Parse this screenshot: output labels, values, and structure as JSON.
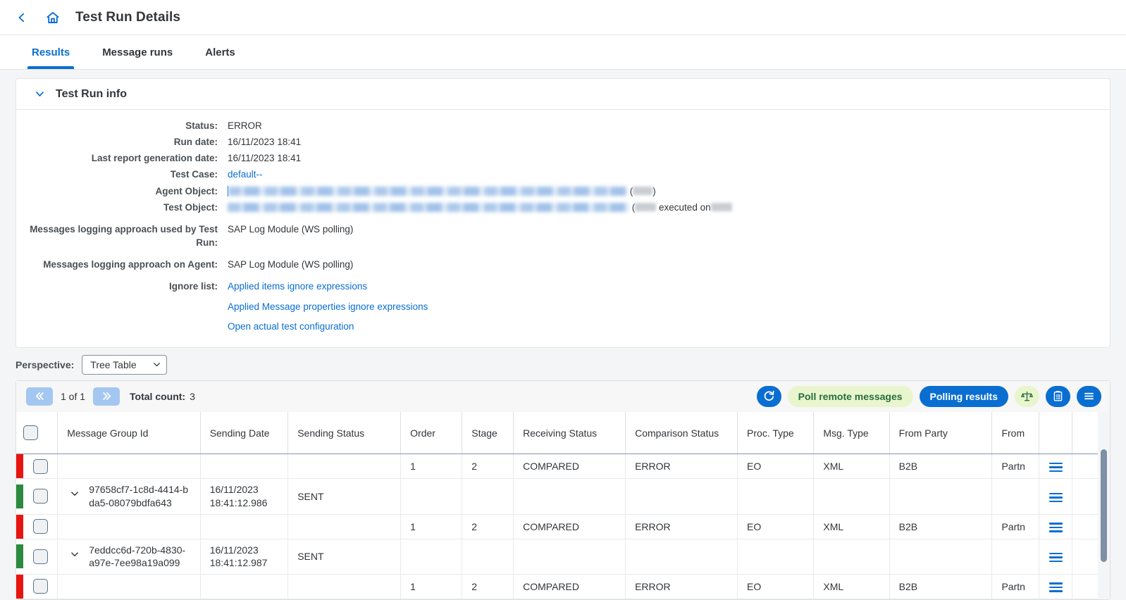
{
  "header": {
    "back_icon": "chevron-left-icon",
    "home_icon": "home-icon",
    "title": "Test Run Details"
  },
  "tabs": [
    {
      "label": "Results",
      "active": true
    },
    {
      "label": "Message runs",
      "active": false
    },
    {
      "label": "Alerts",
      "active": false
    }
  ],
  "test_run_info": {
    "section_title": "Test Run info",
    "expand_icon": "chevron-down-icon",
    "fields": {
      "status_label": "Status:",
      "status_value": "ERROR",
      "run_date_label": "Run date:",
      "run_date_value": "16/11/2023 18:41",
      "last_report_label": "Last report generation date:",
      "last_report_value": "16/11/2023 18:41",
      "test_case_label": "Test Case:",
      "test_case_value": "default--",
      "agent_object_label": "Agent Object:",
      "agent_object_value": "[redacted]",
      "agent_object_suffix_open": "(",
      "agent_object_suffix_close": ")",
      "test_object_label": "Test Object:",
      "test_object_value": "[redacted]",
      "test_object_suffix_open": "(",
      "test_object_suffix_mid": "executed on",
      "logging_used_label": "Messages logging approach used by Test Run:",
      "logging_used_value": "SAP Log Module (WS polling)",
      "logging_agent_label": "Messages logging approach on Agent:",
      "logging_agent_value": "SAP Log Module (WS polling)",
      "ignore_list_label": "Ignore list:",
      "ignore_links": [
        "Applied items ignore expressions",
        "Applied Message properties ignore expressions",
        "Open actual test configuration"
      ]
    }
  },
  "perspective": {
    "label": "Perspective:",
    "selected": "Tree Table",
    "chevron_icon": "chevron-down-icon",
    "options": [
      "Tree Table"
    ]
  },
  "toolbar": {
    "prev_icon": "double-chevron-left-icon",
    "next_icon": "double-chevron-right-icon",
    "page_text": "1 of 1",
    "total_count_label": "Total count:",
    "total_count_value": "3",
    "refresh_icon": "refresh-icon",
    "poll_remote_label": "Poll remote messages",
    "polling_results_label": "Polling results",
    "compare_icon": "scales-icon",
    "clipboard_icon": "clipboard-list-icon",
    "menu_icon": "hamburger-menu-icon",
    "accent_blue": "#0a6ed1",
    "accent_green_bg": "#e8f5cd",
    "accent_green_text": "#256f3a"
  },
  "table": {
    "columns": [
      "Message Group Id",
      "Sending Date",
      "Sending Status",
      "Order",
      "Stage",
      "Receiving Status",
      "Comparison Status",
      "Proc. Type",
      "Msg. Type",
      "From Party",
      "From"
    ],
    "select_all_checkbox": "unchecked",
    "row_menu_icon": "hamburger-menu-icon",
    "status_colors": {
      "error": "#e8150f",
      "ok": "#2b8a3e"
    },
    "rows": [
      {
        "stripe": "error",
        "group_id": "",
        "sending_date": "",
        "sending_status": "",
        "order": "1",
        "stage": "2",
        "receiving_status": "COMPARED",
        "comparison_status": "ERROR",
        "proc_type": "EO",
        "msg_type": "XML",
        "from_party": "B2B",
        "from": "Partn",
        "expandable": false
      },
      {
        "stripe": "ok",
        "group_id": "97658cf7-1c8d-4414-bda5-08079bdfa643",
        "sending_date": "16/11/2023 18:41:12.986",
        "sending_status": "SENT",
        "order": "",
        "stage": "",
        "receiving_status": "",
        "comparison_status": "",
        "proc_type": "",
        "msg_type": "",
        "from_party": "",
        "from": "",
        "expandable": true
      },
      {
        "stripe": "error",
        "group_id": "",
        "sending_date": "",
        "sending_status": "",
        "order": "1",
        "stage": "2",
        "receiving_status": "COMPARED",
        "comparison_status": "ERROR",
        "proc_type": "EO",
        "msg_type": "XML",
        "from_party": "B2B",
        "from": "Partn",
        "expandable": false
      },
      {
        "stripe": "ok",
        "group_id": "7eddcc6d-720b-4830-a97e-7ee98a19a099",
        "sending_date": "16/11/2023 18:41:12.987",
        "sending_status": "SENT",
        "order": "",
        "stage": "",
        "receiving_status": "",
        "comparison_status": "",
        "proc_type": "",
        "msg_type": "",
        "from_party": "",
        "from": "",
        "expandable": true
      },
      {
        "stripe": "error",
        "group_id": "",
        "sending_date": "",
        "sending_status": "",
        "order": "1",
        "stage": "2",
        "receiving_status": "COMPARED",
        "comparison_status": "ERROR",
        "proc_type": "EO",
        "msg_type": "XML",
        "from_party": "B2B",
        "from": "Partn",
        "expandable": false
      }
    ]
  }
}
